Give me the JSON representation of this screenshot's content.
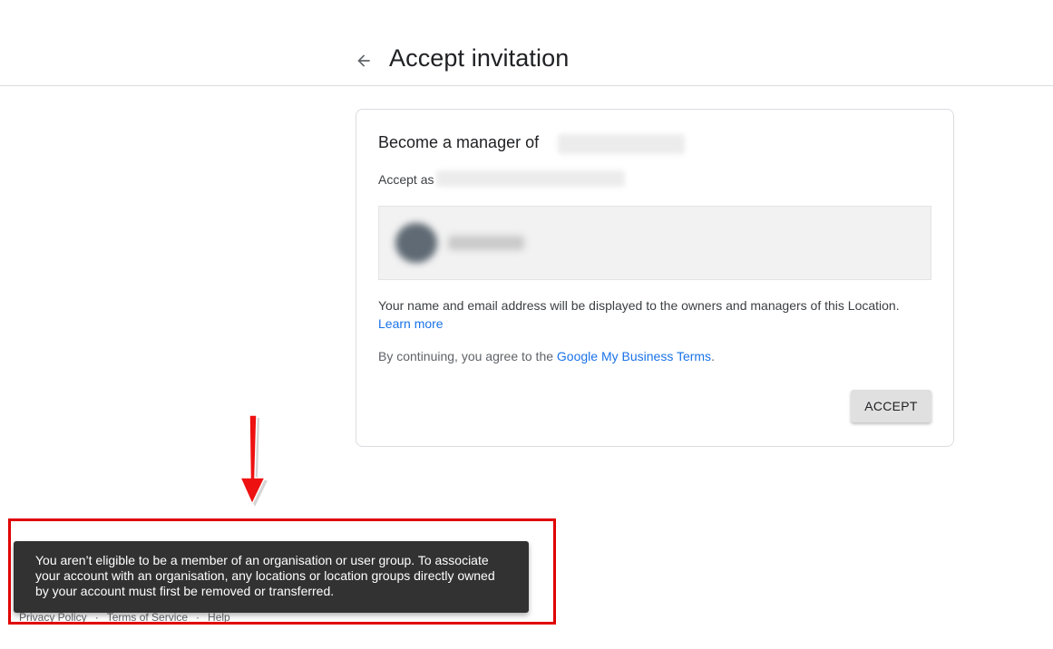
{
  "header": {
    "back_icon": "arrow-left-icon",
    "title": "Accept invitation"
  },
  "card": {
    "title": "Become a manager of",
    "accept_as_label": "Accept as",
    "notice_text": "Your name and email address will be displayed to the owners and managers of this Location.",
    "learn_more_label": "Learn more",
    "terms_prefix": "By continuing, you agree to the",
    "terms_link": "Google My Business Terms",
    "terms_suffix": ".",
    "accept_button": "ACCEPT"
  },
  "footer": {
    "links": [
      "Privacy Policy",
      "Terms of Service",
      "Help"
    ],
    "separator": "·"
  },
  "snackbar": {
    "message": "You aren’t eligible to be a member of an organisation or user group. To associate your account with an organisation, any locations or location groups directly owned by your account must first be removed or transferred."
  },
  "annotation": {
    "highlight_color": "#e00000",
    "arrow_icon": "red-down-arrow"
  },
  "colors": {
    "link": "#1a73e8",
    "snackbar_bg": "#323232",
    "button_bg": "#e0e0e0"
  }
}
